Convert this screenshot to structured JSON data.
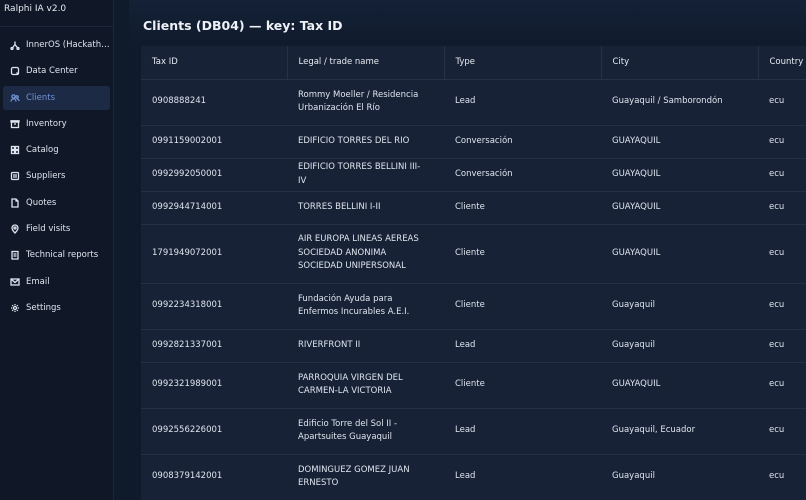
{
  "app": {
    "title": "Ralphi IA v2.0"
  },
  "sidebar": {
    "items": [
      {
        "label": "InnerOS (Hackatho...",
        "icon": "network-icon",
        "active": false
      },
      {
        "label": "Data Center",
        "icon": "database-icon",
        "active": false
      },
      {
        "label": "Clients",
        "icon": "users-icon",
        "active": true
      },
      {
        "label": "Inventory",
        "icon": "box-icon",
        "active": false
      },
      {
        "label": "Catalog",
        "icon": "grid-icon",
        "active": false
      },
      {
        "label": "Suppliers",
        "icon": "truck-icon",
        "active": false
      },
      {
        "label": "Quotes",
        "icon": "document-icon",
        "active": false
      },
      {
        "label": "Field visits",
        "icon": "map-pin-icon",
        "active": false
      },
      {
        "label": "Technical reports",
        "icon": "clipboard-icon",
        "active": false
      },
      {
        "label": "Email",
        "icon": "mail-icon",
        "active": false
      },
      {
        "label": "Settings",
        "icon": "gear-icon",
        "active": false
      }
    ]
  },
  "main": {
    "title": "Clients (DB04) — key: Tax ID",
    "table": {
      "columns": [
        "Tax ID",
        "Legal / trade name",
        "Type",
        "City",
        "Country"
      ],
      "rows": [
        [
          "0908888241",
          "Rommy Moeller / Residencia Urbanización El Río",
          "Lead",
          "Guayaquil / Samborondón",
          "ecu"
        ],
        [
          "0991159002001",
          "EDIFICIO TORRES DEL RIO",
          "Conversación",
          "GUAYAQUIL",
          "ecu"
        ],
        [
          "0992992050001",
          "EDIFICIO TORRES BELLINI III-IV",
          "Conversación",
          "GUAYAQUIL",
          "ecu"
        ],
        [
          "0992944714001",
          "TORRES BELLINI I-II",
          "Cliente",
          "GUAYAQUIL",
          "ecu"
        ],
        [
          "1791949072001",
          "AIR EUROPA LINEAS AEREAS SOCIEDAD ANONIMA SOCIEDAD UNIPERSONAL",
          "Cliente",
          "GUAYAQUIL",
          "ecu"
        ],
        [
          "0992234318001",
          "Fundación Ayuda para Enfermos Incurables A.E.I.",
          "Cliente",
          "Guayaquil",
          "ecu"
        ],
        [
          "0992821337001",
          "RIVERFRONT II",
          "Lead",
          "Guayaquil",
          "ecu"
        ],
        [
          "0992321989001",
          "PARROQUIA VIRGEN DEL CARMEN-LA VICTORIA",
          "Cliente",
          "GUAYAQUIL",
          "ecu"
        ],
        [
          "0992556226001",
          "Edificio Torre del Sol II - Apartsuites Guayaquil",
          "Lead",
          "Guayaquil, Ecuador",
          "ecu"
        ],
        [
          "0908379142001",
          "DOMINGUEZ GOMEZ JUAN ERNESTO",
          "Lead",
          "Guayaquil",
          "ecu"
        ]
      ]
    }
  }
}
